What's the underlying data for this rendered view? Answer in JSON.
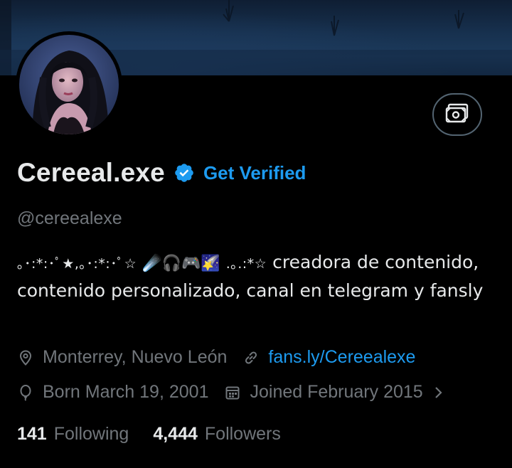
{
  "profile": {
    "name": "Cereeal.exe",
    "get_verified_label": "Get Verified",
    "handle": "@cereealexe",
    "bio": {
      "deco_start": "｡･:*:･ﾟ★,｡･:*:･ﾟ☆",
      "emojis": "☄️🎧🎮🌠",
      "deco_end": ".｡.:*☆",
      "text": "creadora de contenido, contenido personalizado, canal en telegram y fansly"
    },
    "location": "Monterrey, Nuevo León",
    "website": "fans.ly/Cereealexe",
    "birthday": "Born March 19, 2001",
    "joined": "Joined February 2015",
    "following_count": "141",
    "following_label": "Following",
    "followers_count": "4,444",
    "followers_label": "Followers"
  },
  "icons": {
    "verified": "verified-badge-icon",
    "money": "money-icon",
    "location": "location-pin-icon",
    "link": "link-icon",
    "birthday": "balloon-icon",
    "calendar": "calendar-icon",
    "chevron": "chevron-right-icon"
  },
  "colors": {
    "background": "#000000",
    "text_primary": "#e7e9ea",
    "text_secondary": "#71767b",
    "accent": "#1d9bf0",
    "border": "#536471"
  }
}
